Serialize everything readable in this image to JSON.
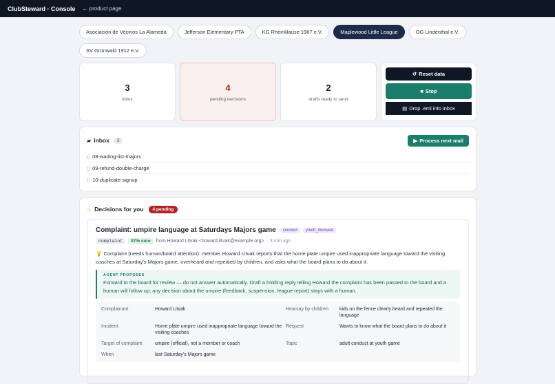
{
  "header": {
    "brand": "ClubSteward · Console",
    "back": "← product page"
  },
  "orgs": [
    {
      "label": "Asociación de Vecinos La Alameda",
      "active": false
    },
    {
      "label": "Jefferson Elementary PTA",
      "active": false
    },
    {
      "label": "KG Rheinklause 1967 e.V.",
      "active": false
    },
    {
      "label": "Maplewood Little League",
      "active": true
    },
    {
      "label": "OG Lindenthal e.V.",
      "active": false
    },
    {
      "label": "SV Grünwald 1912 e.V.",
      "active": false
    }
  ],
  "stats": [
    {
      "value": "3",
      "label": "inbox"
    },
    {
      "value": "4",
      "label": "pending decisions"
    },
    {
      "value": "2",
      "label": "drafts ready to send"
    }
  ],
  "actions": {
    "reset": "Reset data",
    "stop": "Stop",
    "drop": "Drop .eml into inbox"
  },
  "inbox": {
    "title": "Inbox",
    "count": "3",
    "process_label": "Process next mail",
    "mails": [
      "08-waiting-list-majors",
      "09-refund-double-charge",
      "10-duplicate-signup"
    ]
  },
  "decisions": {
    "title": "Decisions for you",
    "pending": "4 pending",
    "item": {
      "title": "Complaint: umpire language at Saturdays Majors game",
      "tags": [
        "conduct",
        "youth_involved"
      ],
      "kind": "complaint",
      "confidence": "97% sure",
      "from": "from Howard Litvak <howard.litvak@example.org>",
      "age": "· 3 min ago",
      "summary": "Complaint (needs human/board attention): member Howard Litvak reports that the home plate umpire used inappropriate language toward the visiting coaches at Saturday's Majors game, overheard and repeated by children, and asks what the board plans to do about it.",
      "proposal_label": "AGENT PROPOSES",
      "proposal": "Forward to the board for review — do not answer automatically. Draft a holding reply telling Howard the complaint has been passed to the board and a human will follow up; any decision about the umpire (feedback, suspension, league report) stays with a human.",
      "facts": [
        {
          "k": "Complainant",
          "v": "Howard Litvak"
        },
        {
          "k": "Hearsay by children",
          "v": "kids on the fence clearly heard and repeated the language"
        },
        {
          "k": "Incident",
          "v": "Home plate umpire used inappropriate language toward the visiting coaches"
        },
        {
          "k": "Request",
          "v": "Wants to know what the board plans to do about it"
        },
        {
          "k": "Target of complaint",
          "v": "umpire (official), not a member or coach"
        },
        {
          "k": "Topic",
          "v": "adult conduct at youth game"
        },
        {
          "k": "When",
          "v": "last Saturday's Majors game"
        }
      ]
    }
  }
}
